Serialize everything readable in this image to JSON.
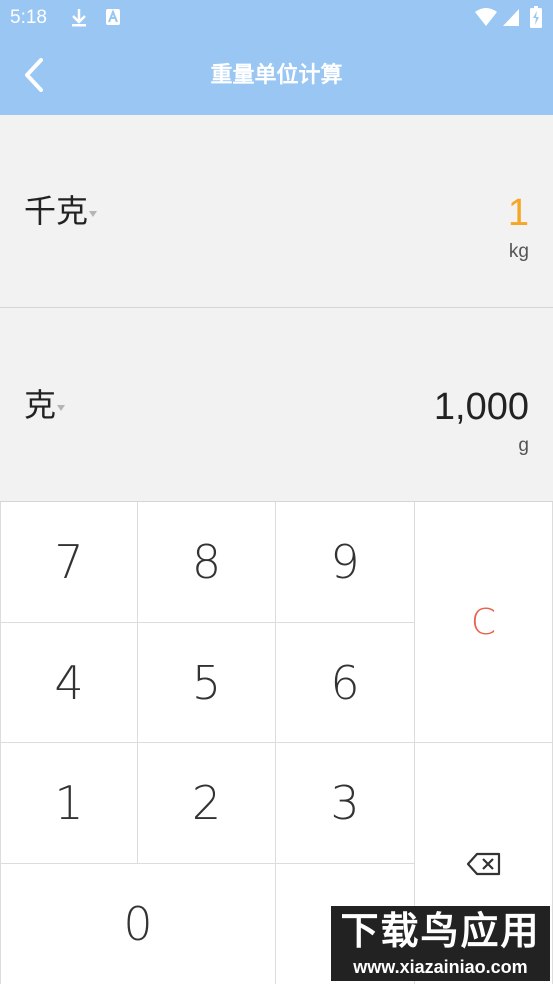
{
  "status_bar": {
    "time": "5:18",
    "icons": [
      "download-icon",
      "app-a-icon",
      "wifi-icon",
      "signal-icon",
      "battery-charging-icon"
    ]
  },
  "header": {
    "title": "重量单位计算",
    "back_icon": "chevron-left-icon",
    "background_color": "#99c6f2"
  },
  "from_unit": {
    "name": "千克",
    "value": "1",
    "symbol": "kg",
    "value_color": "#f5a623"
  },
  "to_unit": {
    "name": "克",
    "value": "1,000",
    "symbol": "g"
  },
  "keypad": {
    "keys": {
      "k7": "7",
      "k8": "8",
      "k9": "9",
      "k4": "4",
      "k5": "5",
      "k6": "6",
      "k1": "1",
      "k2": "2",
      "k3": "3",
      "k0": "0"
    },
    "clear_label": "C",
    "clear_color": "#e8624e",
    "backspace_icon": "backspace-icon"
  },
  "watermark": {
    "title": "下载鸟应用",
    "url": "www.xiazainiao.com"
  }
}
